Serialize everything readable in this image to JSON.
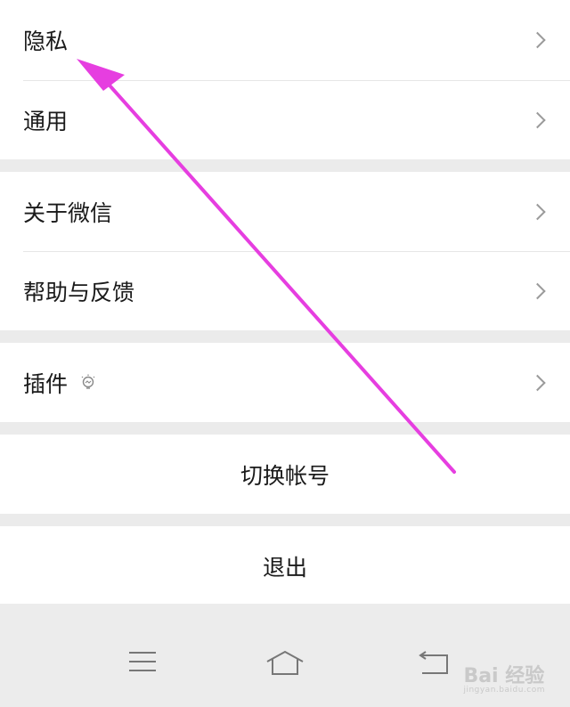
{
  "menu_groups": [
    {
      "items": [
        {
          "label": "隐私"
        },
        {
          "label": "通用"
        }
      ]
    },
    {
      "items": [
        {
          "label": "关于微信"
        },
        {
          "label": "帮助与反馈"
        }
      ]
    },
    {
      "items": [
        {
          "label": "插件",
          "icon": "lightbulb-icon"
        }
      ]
    }
  ],
  "actions": {
    "switch_account": "切换帐号",
    "logout": "退出"
  },
  "watermark": {
    "brand": "Bai 经验",
    "url": "jingyan.baidu.com"
  },
  "annotation": {
    "color": "#e63ee0"
  }
}
